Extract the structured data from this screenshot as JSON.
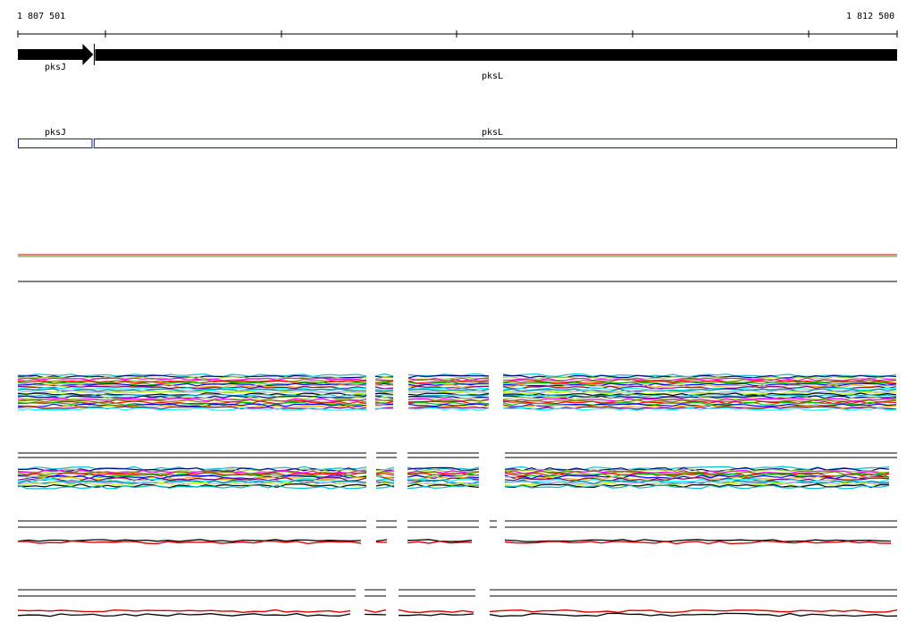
{
  "ruler": {
    "start_label": "1 807 501",
    "end_label": "1 812 500",
    "start": 1807501,
    "end": 1812500
  },
  "genes": [
    {
      "name": "pksJ",
      "start": 1807501,
      "end": 1807930,
      "strand": "+"
    },
    {
      "name": "pksL",
      "start": 1807930,
      "end": 1812500,
      "strand": "+"
    }
  ],
  "gene_boxes": [
    {
      "name": "pksJ",
      "start": 1807501,
      "end": 1807925
    },
    {
      "name": "pksL",
      "start": 1807932,
      "end": 1812500
    }
  ],
  "colors": {
    "gene_arrow": "#000000",
    "gene_box": "#1a1aa8",
    "separator": "#000000",
    "trace_palette": [
      "#00bcd4",
      "#000080",
      "#9acd32",
      "#ff00ff",
      "#808000",
      "#ff0000",
      "#00c000",
      "#0000ff",
      "#ffa500",
      "#800080",
      "#00ffff",
      "#008080",
      "#a0a0ff",
      "#c0ff00",
      "#000000"
    ],
    "red_trace": "#dd0000",
    "black_trace": "#000000"
  }
}
